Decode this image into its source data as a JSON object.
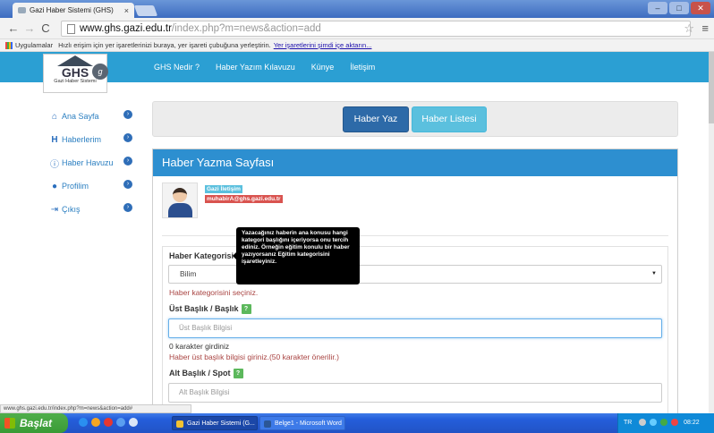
{
  "browser": {
    "tab_title": "Gazi Haber Sistemi (GHS)",
    "tab_close": "×",
    "url_host": "www.ghs.gazi.edu.tr",
    "url_path": "/index.php?m=news&action=add",
    "bookmarks_apps": "Uygulamalar",
    "bookmarks_text": "Hızlı erişim için yer işaretlerinizi buraya, yer işareti çubuğuna yerleştirin.",
    "bookmarks_link": "Yer işaretlerini şimdi içe aktarın..."
  },
  "site": {
    "logo_text": "GHS",
    "logo_sub": "Gazi Haber Sistemi",
    "nav": [
      "GHS Nedir ?",
      "Haber Yazım Kılavuzu",
      "Künye",
      "İletişim"
    ]
  },
  "sidebar": {
    "items": [
      {
        "label": "Ana Sayfa",
        "icon": "home-icon"
      },
      {
        "label": "Haberlerim",
        "icon": "h-icon"
      },
      {
        "label": "Haber Havuzu",
        "icon": "info-icon"
      },
      {
        "label": "Profilim",
        "icon": "user-icon"
      },
      {
        "label": "Çıkış",
        "icon": "logout-icon"
      }
    ]
  },
  "actions": {
    "write_label": "Haber Yaz",
    "list_label": "Haber Listesi"
  },
  "page": {
    "title": "Haber Yazma Sayfası",
    "user_badge": "Gazi İletişim",
    "user_email": "muhabirA@ghs.gazi.edu.tr"
  },
  "form": {
    "category_label": "Haber Kategorisi",
    "category_value": "Bilim",
    "category_error": "Haber kategorisini seçiniz.",
    "title_label": "Üst Başlık / Başlık",
    "title_placeholder": "Üst Başlık Bilgisi",
    "title_count": "0 karakter girdiniz",
    "title_hint": "Haber üst başlık bilgisi giriniz.(50 karakter önerilir.)",
    "spot_label": "Alt Başlık / Spot",
    "spot_placeholder": "Alt Başlık Bilgisi",
    "help_glyph": "?"
  },
  "tooltip": {
    "text": "Yazacağınız haberin ana konusu hangi kategori başlığını içeriyorsa onu tercih ediniz. Örneğin eğitim konulu bir haber yazıyorsanız Eğitim kategorisini işaretleyiniz."
  },
  "status_url": "www.ghs.gazi.edu.tr/index.php?m=news&action=add#",
  "taskbar": {
    "start_label": "Başlat",
    "tasks": [
      "Gazi Haber Sistemi (G...",
      "Belge1 - Microsoft Word"
    ],
    "tray_lang": "TR",
    "clock": "08:22"
  },
  "colors": {
    "header_blue": "#2b9fd3",
    "panel_blue": "#2d8fd0",
    "primary": "#2d6aa8",
    "info": "#5bc0de",
    "danger": "#d9534f",
    "success": "#5cb85c"
  }
}
